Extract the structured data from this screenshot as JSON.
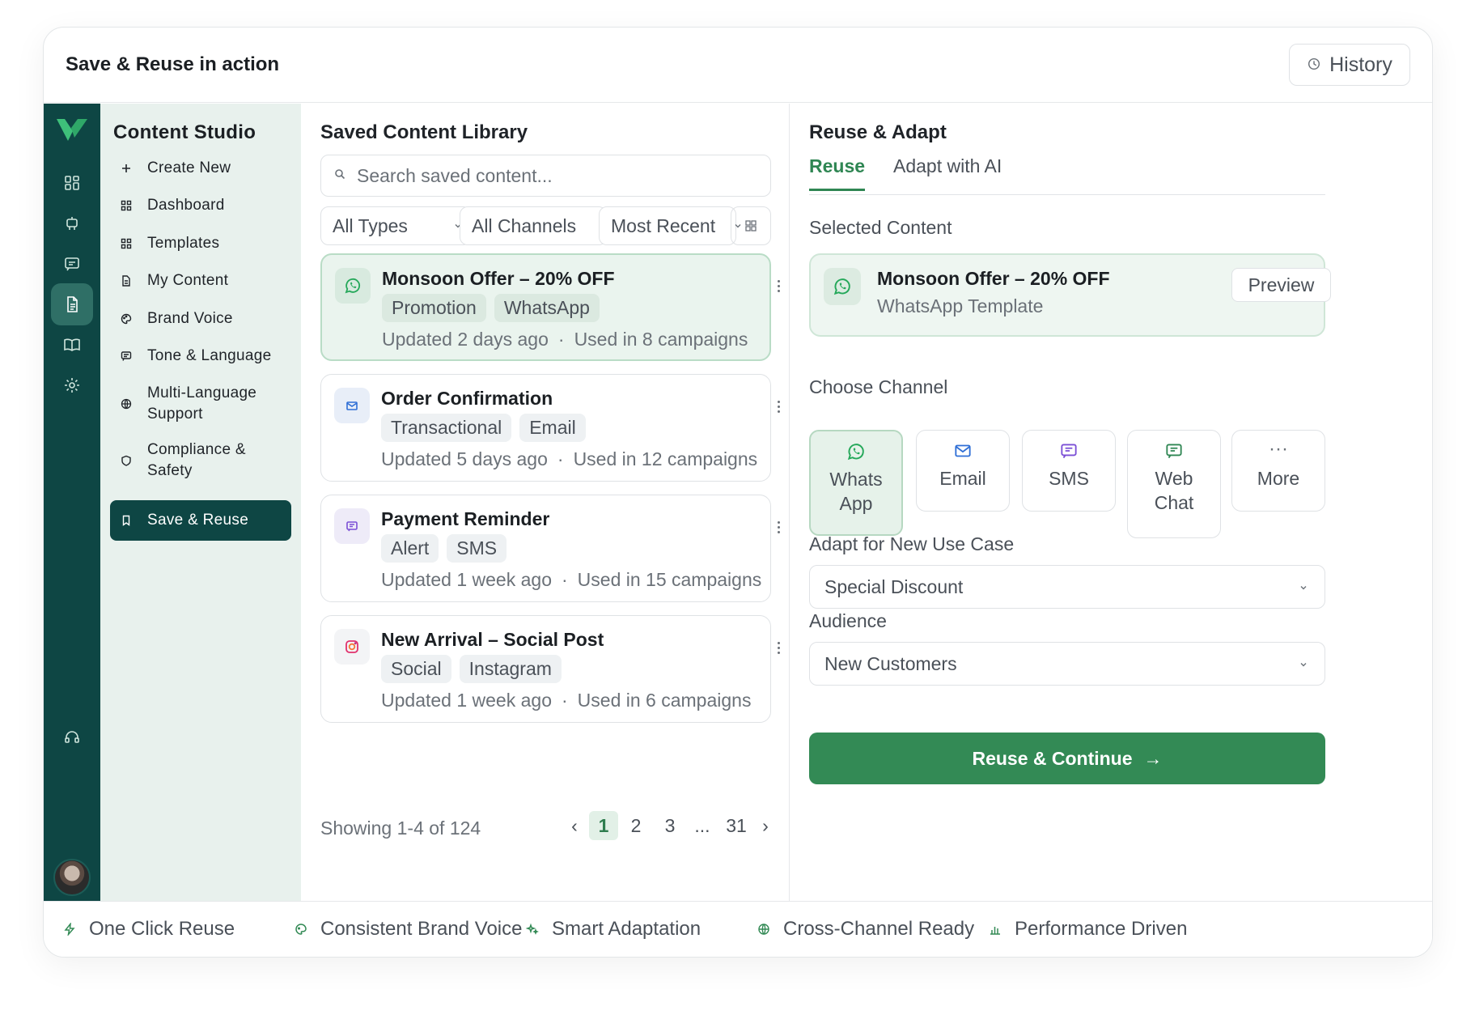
{
  "header": {
    "title": "Save & Reuse in action",
    "history_label": "History"
  },
  "sidebar": {
    "title": "Content Studio",
    "items": [
      {
        "label": "Create New",
        "icon": "plus-icon"
      },
      {
        "label": "Dashboard",
        "icon": "grid-icon"
      },
      {
        "label": "Templates",
        "icon": "grid-icon"
      },
      {
        "label": "My Content",
        "icon": "document-icon"
      },
      {
        "label": "Brand Voice",
        "icon": "palette-icon"
      },
      {
        "label": "Tone & Language",
        "icon": "chat-icon"
      },
      {
        "label": "Multi-Language Support",
        "icon": "globe-icon"
      },
      {
        "label": "Compliance & Safety",
        "icon": "shield-icon"
      },
      {
        "label": "Save & Reuse",
        "icon": "bookmark-icon",
        "active": true
      }
    ]
  },
  "library": {
    "title": "Saved Content Library",
    "search_placeholder": "Search saved content...",
    "filters": [
      "All Types",
      "All Channels",
      "Most Recent"
    ],
    "items": [
      {
        "title": "Monsoon Offer – 20% OFF",
        "tags": [
          "Promotion",
          "WhatsApp"
        ],
        "updated": "Updated 2 days ago",
        "used": "Used in 8 campaigns",
        "icon": "whatsapp-icon",
        "selected": true
      },
      {
        "title": "Order Confirmation",
        "tags": [
          "Transactional",
          "Email"
        ],
        "updated": "Updated 5 days ago",
        "used": "Used in 12 campaigns",
        "icon": "email-icon"
      },
      {
        "title": "Payment Reminder",
        "tags": [
          "Alert",
          "SMS"
        ],
        "updated": "Updated 1 week ago",
        "used": "Used in 15 campaigns",
        "icon": "sms-icon"
      },
      {
        "title": "New Arrival – Social Post",
        "tags": [
          "Social",
          "Instagram"
        ],
        "updated": "Updated 1 week ago",
        "used": "Used in 6 campaigns",
        "icon": "instagram-icon"
      }
    ],
    "separator": "·",
    "showing": "Showing 1-4 of 124",
    "pages": [
      "1",
      "2",
      "3",
      "...",
      "31"
    ],
    "current_page": "1"
  },
  "adapt": {
    "title": "Reuse & Adapt",
    "tabs": [
      "Reuse",
      "Adapt with AI"
    ],
    "selected_label": "Selected Content",
    "selected": {
      "title": "Monsoon Offer – 20% OFF",
      "subtitle": "WhatsApp Template",
      "preview_label": "Preview"
    },
    "channel_label": "Choose Channel",
    "channels": [
      {
        "line1": "Whats",
        "line2": "App",
        "icon": "whatsapp-icon",
        "active": true
      },
      {
        "line1": "Email",
        "line2": "",
        "icon": "email-icon"
      },
      {
        "line1": "SMS",
        "line2": "",
        "icon": "sms-icon"
      },
      {
        "line1": "Web",
        "line2": "Chat",
        "icon": "webchat-icon"
      },
      {
        "line1": "More",
        "line2": "",
        "icon": "more-icon",
        "glyph": "···"
      }
    ],
    "usecase_label": "Adapt for New Use Case",
    "usecase_value": "Special Discount",
    "audience_label": "Audience",
    "audience_value": "New Customers",
    "cta_label": "Reuse & Continue",
    "cta_arrow": "→"
  },
  "footer": {
    "features": [
      "One Click Reuse",
      "Consistent Brand Voice",
      "Smart Adaptation",
      "Cross-Channel Ready",
      "Performance Driven"
    ]
  },
  "colors": {
    "brand_dark": "#0e4644",
    "accent_green": "#338a55",
    "whatsapp": "#25d366",
    "email": "#2f6fd6",
    "sms": "#7b4fd6"
  },
  "pager_glyphs": {
    "prev": "‹",
    "next": "›"
  }
}
